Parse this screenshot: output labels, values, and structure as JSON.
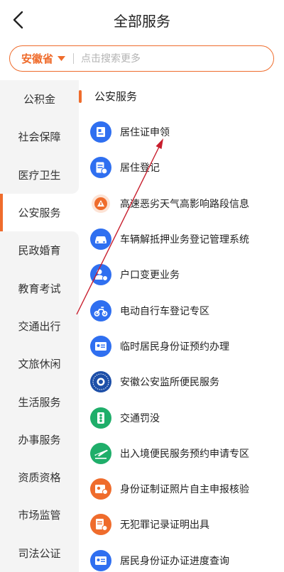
{
  "header": {
    "title": "全部服务"
  },
  "search": {
    "province": "安徽省",
    "placeholder": "点击搜索更多"
  },
  "sidebar": {
    "items": [
      {
        "label": "公积金"
      },
      {
        "label": "社会保障"
      },
      {
        "label": "医疗卫生"
      },
      {
        "label": "公安服务"
      },
      {
        "label": "民政婚育"
      },
      {
        "label": "教育考试"
      },
      {
        "label": "交通出行"
      },
      {
        "label": "文旅休闲"
      },
      {
        "label": "生活服务"
      },
      {
        "label": "办事服务"
      },
      {
        "label": "资质资格"
      },
      {
        "label": "市场监管"
      },
      {
        "label": "司法公证"
      }
    ],
    "active_label": "公安服务"
  },
  "main": {
    "section_title": "公安服务",
    "services": [
      {
        "label": "居住证申领",
        "icon": "residence-permit-icon",
        "color": "#2f6ff0"
      },
      {
        "label": "居住登记",
        "icon": "residence-registration-icon",
        "color": "#2f6ff0"
      },
      {
        "label": "高速恶劣天气高影响路段信息",
        "icon": "highway-weather-icon",
        "color": "#ef6c2c"
      },
      {
        "label": "车辆解抵押业务登记管理系统",
        "icon": "vehicle-icon",
        "color": "#2f6ff0"
      },
      {
        "label": "户口变更业务",
        "icon": "household-change-icon",
        "color": "#2f6ff0"
      },
      {
        "label": "电动自行车登记专区",
        "icon": "e-bike-icon",
        "color": "#2f6ff0"
      },
      {
        "label": "临时居民身份证预约办理",
        "icon": "temporary-id-icon",
        "color": "#2f6ff0"
      },
      {
        "label": "安徽公安监所便民服务",
        "icon": "police-emblem-icon",
        "color": "#2f6ff0"
      },
      {
        "label": "交通罚没",
        "icon": "traffic-fine-icon",
        "color": "#1fae6a"
      },
      {
        "label": "出入境便民服务预约申请专区",
        "icon": "airplane-icon",
        "color": "#1fae6a"
      },
      {
        "label": "身份证制证照片自主申报核验",
        "icon": "id-photo-icon",
        "color": "#ef6c2c"
      },
      {
        "label": "无犯罪记录证明出具",
        "icon": "no-crime-certificate-icon",
        "color": "#ef6c2c"
      },
      {
        "label": "居民身份证办证进度查询",
        "icon": "id-progress-icon",
        "color": "#2f6ff0"
      }
    ]
  },
  "colors": {
    "accent": "#ef6c2c",
    "blue": "#2f6ff0",
    "green": "#1fae6a",
    "annotation_arrow": "#c81e2d"
  }
}
